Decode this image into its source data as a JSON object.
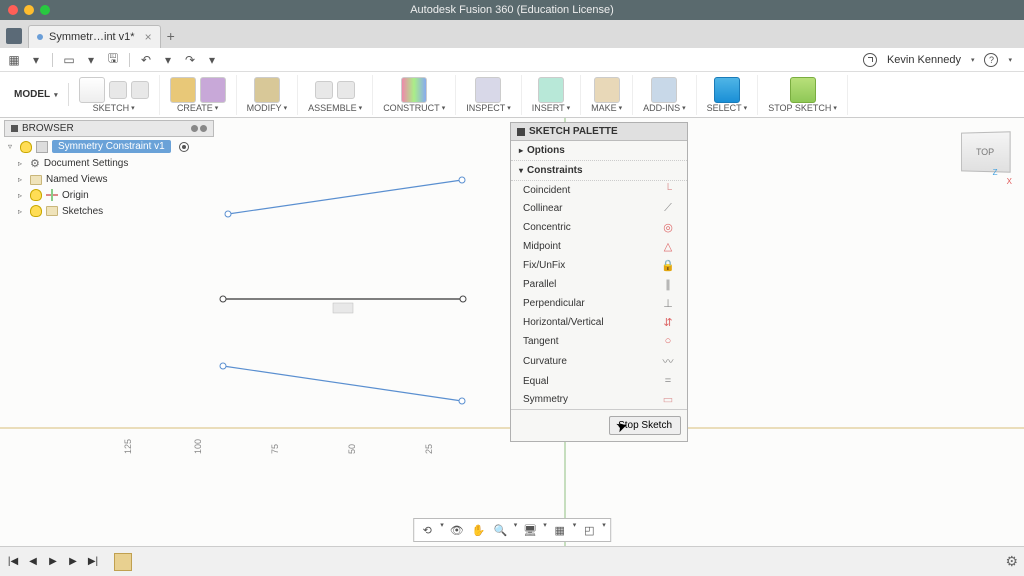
{
  "titlebar": {
    "title": "Autodesk Fusion 360 (Education License)"
  },
  "tab": {
    "name": "Symmetr…int v1*"
  },
  "user": {
    "name": "Kevin Kennedy"
  },
  "ribbon": {
    "model": "MODEL",
    "groups": {
      "sketch": "SKETCH",
      "create": "CREATE",
      "modify": "MODIFY",
      "assemble": "ASSEMBLE",
      "construct": "CONSTRUCT",
      "inspect": "INSPECT",
      "insert": "INSERT",
      "make": "MAKE",
      "addins": "ADD-INS",
      "select": "SELECT",
      "stopsketch": "STOP SKETCH"
    }
  },
  "browser": {
    "title": "BROWSER",
    "root": "Symmetry Constraint v1",
    "items": {
      "doc": "Document Settings",
      "views": "Named Views",
      "origin": "Origin",
      "sketches": "Sketches"
    }
  },
  "palette": {
    "title": "SKETCH PALETTE",
    "options": "Options",
    "constraints": "Constraints",
    "items": {
      "coincident": "Coincident",
      "collinear": "Collinear",
      "concentric": "Concentric",
      "midpoint": "Midpoint",
      "fixunfix": "Fix/UnFix",
      "parallel": "Parallel",
      "perpendicular": "Perpendicular",
      "hv": "Horizontal/Vertical",
      "tangent": "Tangent",
      "curvature": "Curvature",
      "equal": "Equal",
      "symmetry": "Symmetry"
    },
    "stop": "Stop Sketch"
  },
  "ruler": {
    "t125": "125",
    "t100": "100",
    "t75": "75",
    "t50": "50",
    "t25": "25"
  },
  "viewcube": "TOP",
  "axes": {
    "z": "Z",
    "x": "X"
  }
}
